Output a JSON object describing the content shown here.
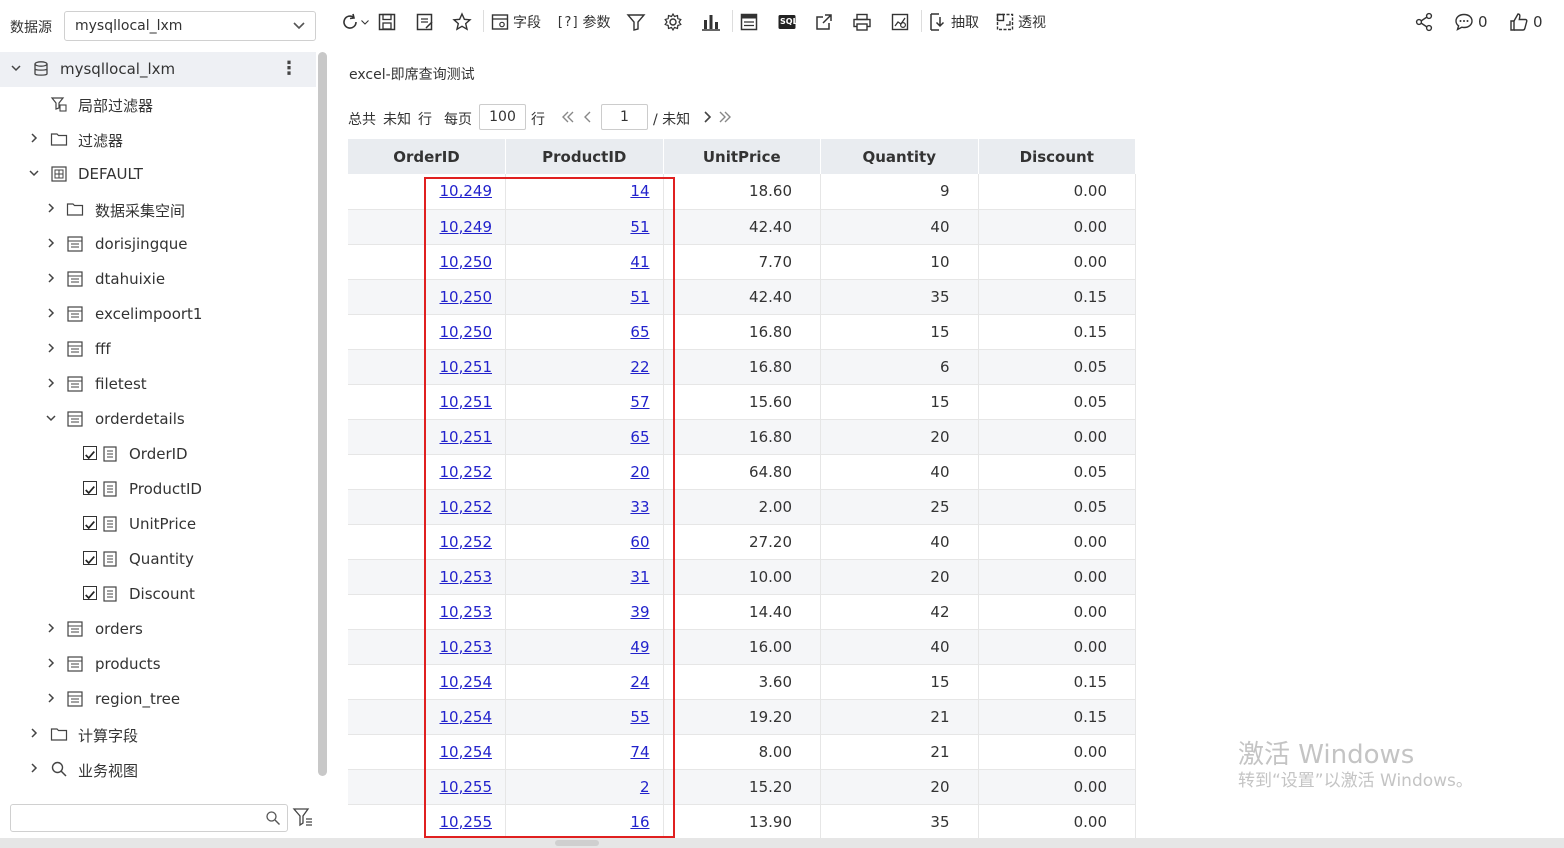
{
  "datasource": {
    "label": "数据源",
    "selected": "mysqllocal_lxm"
  },
  "tree": {
    "root": "mysqllocal_lxm",
    "more_icon": "more-vertical-icon",
    "items": [
      {
        "label": "局部过滤器",
        "icon": "local-filter-icon"
      },
      {
        "label": "过滤器",
        "icon": "folder-icon"
      },
      {
        "label": "DEFAULT",
        "icon": "schema-icon"
      },
      {
        "label": "数据采集空间",
        "icon": "folder-icon"
      },
      {
        "label": "dorisjingque",
        "icon": "table-icon"
      },
      {
        "label": "dtahuixie",
        "icon": "table-icon"
      },
      {
        "label": "excelimpoort1",
        "icon": "table-icon"
      },
      {
        "label": "fff",
        "icon": "table-icon"
      },
      {
        "label": "filetest",
        "icon": "table-icon"
      },
      {
        "label": "orderdetails",
        "icon": "table-icon"
      },
      {
        "label": "OrderID",
        "icon": "field-icon",
        "checked": true
      },
      {
        "label": "ProductID",
        "icon": "field-icon",
        "checked": true
      },
      {
        "label": "UnitPrice",
        "icon": "field-icon",
        "checked": true
      },
      {
        "label": "Quantity",
        "icon": "field-icon",
        "checked": true
      },
      {
        "label": "Discount",
        "icon": "field-icon",
        "checked": true
      },
      {
        "label": "orders",
        "icon": "table-icon"
      },
      {
        "label": "products",
        "icon": "table-icon"
      },
      {
        "label": "region_tree",
        "icon": "table-icon"
      },
      {
        "label": "计算字段",
        "icon": "folder-icon"
      },
      {
        "label": "业务视图",
        "icon": "search-icon"
      }
    ],
    "search_placeholder": ""
  },
  "toolbar": {
    "fields_label": "字段",
    "params_label": "参数",
    "params_prefix": "[?]",
    "extract_label": "抽取",
    "pivot_label": "透视",
    "sql_label": "SQL"
  },
  "header_right": {
    "comments_count": "0",
    "likes_count": "0"
  },
  "report": {
    "title": "excel-即席查询测试"
  },
  "pager": {
    "total_prefix": "总共",
    "total_value": "未知",
    "total_suffix": "行",
    "per_page_label": "每页",
    "per_page_value": "100",
    "per_page_suffix": "行",
    "current_page": "1",
    "page_total": "/ 未知"
  },
  "grid": {
    "columns": [
      "OrderID",
      "ProductID",
      "UnitPrice",
      "Quantity",
      "Discount"
    ],
    "rows": [
      [
        "10,249",
        "14",
        "18.60",
        "9",
        "0.00"
      ],
      [
        "10,249",
        "51",
        "42.40",
        "40",
        "0.00"
      ],
      [
        "10,250",
        "41",
        "7.70",
        "10",
        "0.00"
      ],
      [
        "10,250",
        "51",
        "42.40",
        "35",
        "0.15"
      ],
      [
        "10,250",
        "65",
        "16.80",
        "15",
        "0.15"
      ],
      [
        "10,251",
        "22",
        "16.80",
        "6",
        "0.05"
      ],
      [
        "10,251",
        "57",
        "15.60",
        "15",
        "0.05"
      ],
      [
        "10,251",
        "65",
        "16.80",
        "20",
        "0.00"
      ],
      [
        "10,252",
        "20",
        "64.80",
        "40",
        "0.05"
      ],
      [
        "10,252",
        "33",
        "2.00",
        "25",
        "0.05"
      ],
      [
        "10,252",
        "60",
        "27.20",
        "40",
        "0.00"
      ],
      [
        "10,253",
        "31",
        "10.00",
        "20",
        "0.00"
      ],
      [
        "10,253",
        "39",
        "14.40",
        "42",
        "0.00"
      ],
      [
        "10,253",
        "49",
        "16.00",
        "40",
        "0.00"
      ],
      [
        "10,254",
        "24",
        "3.60",
        "15",
        "0.15"
      ],
      [
        "10,254",
        "55",
        "19.20",
        "21",
        "0.15"
      ],
      [
        "10,254",
        "74",
        "8.00",
        "21",
        "0.00"
      ],
      [
        "10,255",
        "2",
        "15.20",
        "20",
        "0.00"
      ],
      [
        "10,255",
        "16",
        "13.90",
        "35",
        "0.00"
      ]
    ]
  },
  "watermark": {
    "line1": "激活 Windows",
    "line2": "转到“设置”以激活 Windows。"
  },
  "colors": {
    "link": "#2222cc",
    "highlight_border": "#e02020",
    "header_bg": "#e9ecf0"
  }
}
